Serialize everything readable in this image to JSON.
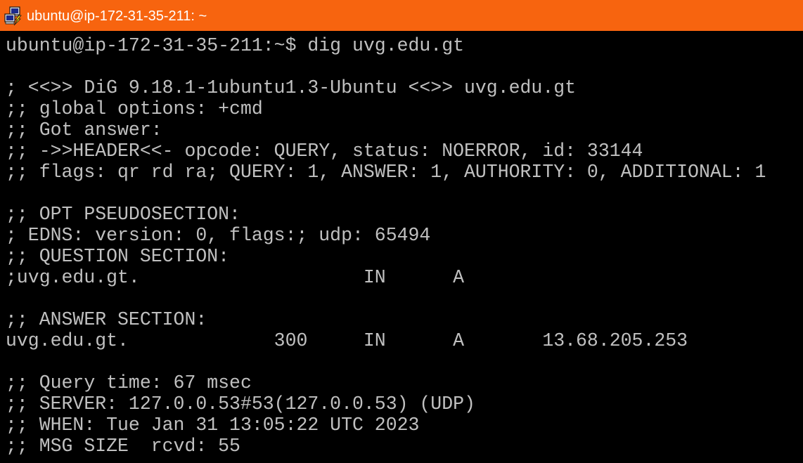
{
  "window": {
    "title": "ubuntu@ip-172-31-35-211: ~",
    "app_icon": "putty-icon",
    "titlebar_color": "#f7640f",
    "background_color": "#000000",
    "text_color": "#c0c0c0"
  },
  "terminal": {
    "lines": [
      "ubuntu@ip-172-31-35-211:~$ dig uvg.edu.gt",
      "",
      "; <<>> DiG 9.18.1-1ubuntu1.3-Ubuntu <<>> uvg.edu.gt",
      ";; global options: +cmd",
      ";; Got answer:",
      ";; ->>HEADER<<- opcode: QUERY, status: NOERROR, id: 33144",
      ";; flags: qr rd ra; QUERY: 1, ANSWER: 1, AUTHORITY: 0, ADDITIONAL: 1",
      "",
      ";; OPT PSEUDOSECTION:",
      "; EDNS: version: 0, flags:; udp: 65494",
      ";; QUESTION SECTION:",
      ";uvg.edu.gt.                    IN      A",
      "",
      ";; ANSWER SECTION:",
      "uvg.edu.gt.             300     IN      A       13.68.205.253",
      "",
      ";; Query time: 67 msec",
      ";; SERVER: 127.0.0.53#53(127.0.0.53) (UDP)",
      ";; WHEN: Tue Jan 31 13:05:22 UTC 2023",
      ";; MSG SIZE  rcvd: 55"
    ]
  }
}
